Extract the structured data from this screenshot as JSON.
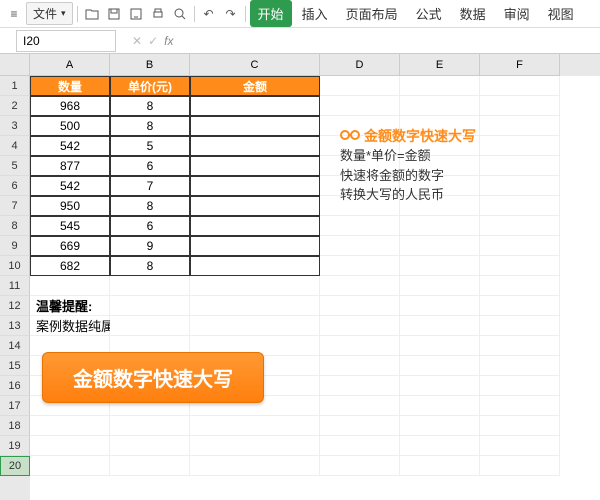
{
  "menu": {
    "file": "文件",
    "tabs": [
      "开始",
      "插入",
      "页面布局",
      "公式",
      "数据",
      "审阅",
      "视图"
    ],
    "activeTab": 0
  },
  "nameBox": "I20",
  "fx": "fx",
  "columns": [
    "A",
    "B",
    "C",
    "D",
    "E",
    "F"
  ],
  "rowCount": 20,
  "selectedRow": 20,
  "headers": {
    "A": "数量",
    "B": "单价(元)",
    "C": "金额"
  },
  "data": [
    {
      "qty": "968",
      "price": "8"
    },
    {
      "qty": "500",
      "price": "8"
    },
    {
      "qty": "542",
      "price": "5"
    },
    {
      "qty": "877",
      "price": "6"
    },
    {
      "qty": "542",
      "price": "7"
    },
    {
      "qty": "950",
      "price": "8"
    },
    {
      "qty": "545",
      "price": "6"
    },
    {
      "qty": "669",
      "price": "9"
    },
    {
      "qty": "682",
      "price": "8"
    }
  ],
  "sideNote": {
    "title": "金额数字快速大写",
    "lines": [
      "数量*单价=金额",
      "快速将金额的数字",
      "转换大写的人民币"
    ]
  },
  "tip": {
    "title": "温馨提醒:",
    "text": "案例数据纯属虚构，如有雷同纯属巧合"
  },
  "bigButton": "金额数字快速大写"
}
